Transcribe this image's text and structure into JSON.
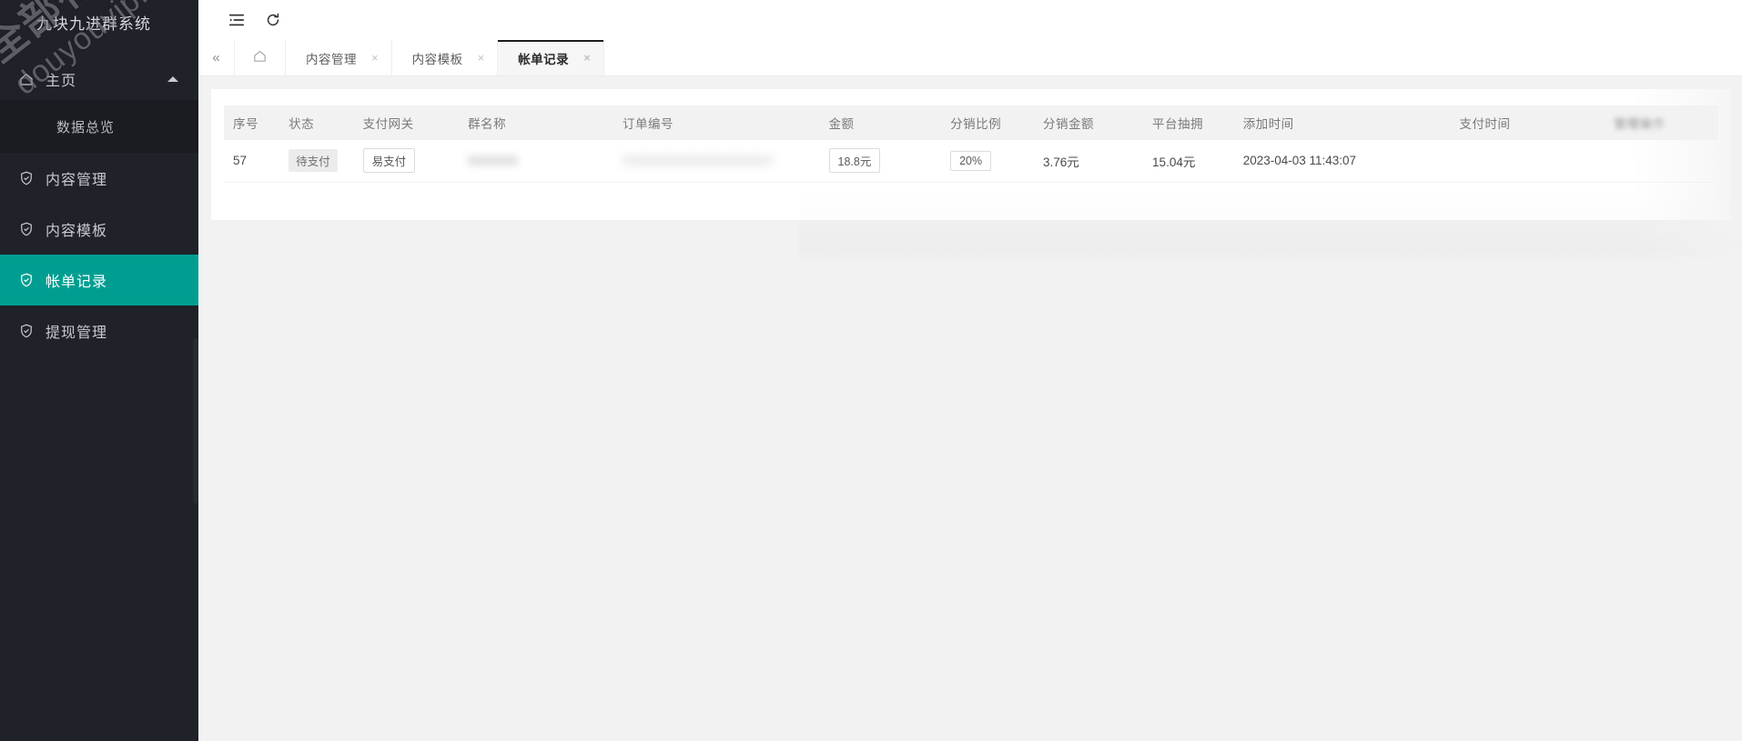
{
  "sidebar": {
    "logo_text": "九块九进群系统",
    "watermark_line1": "全部有综合资源网",
    "watermark_line2": "douyouvip.com",
    "group": {
      "label": "主页",
      "icon": "home-icon",
      "expanded": true,
      "children": [
        {
          "label": "数据总览"
        }
      ]
    },
    "items": [
      {
        "label": "内容管理",
        "icon": "shield-check-icon",
        "active": false
      },
      {
        "label": "内容模板",
        "icon": "shield-check-icon",
        "active": false
      },
      {
        "label": "帐单记录",
        "icon": "shield-check-icon",
        "active": true
      },
      {
        "label": "提现管理",
        "icon": "shield-check-icon",
        "active": false
      }
    ],
    "active_color": "#009e91",
    "bg_color": "#20222a"
  },
  "topbar": {
    "menu_toggle": "list-collapse-icon",
    "refresh": "refresh-icon"
  },
  "tabbar": {
    "collapse_label": "«",
    "home_icon": "home-outline-icon",
    "close_label": "×",
    "tabs": [
      {
        "label": "内容管理",
        "active": false,
        "closable": true
      },
      {
        "label": "内容模板",
        "active": false,
        "closable": true
      },
      {
        "label": "帐单记录",
        "active": true,
        "closable": true
      }
    ]
  },
  "table": {
    "columns": [
      {
        "key": "idx",
        "label": "序号"
      },
      {
        "key": "status",
        "label": "状态"
      },
      {
        "key": "gateway",
        "label": "支付网关"
      },
      {
        "key": "group",
        "label": "群名称"
      },
      {
        "key": "order",
        "label": "订单编号"
      },
      {
        "key": "amount",
        "label": "金额"
      },
      {
        "key": "ratio",
        "label": "分销比例"
      },
      {
        "key": "share",
        "label": "分销金额"
      },
      {
        "key": "plat",
        "label": "平台抽拥"
      },
      {
        "key": "addtime",
        "label": "添加时间"
      },
      {
        "key": "paytime",
        "label": "支付时间"
      },
      {
        "key": "op",
        "label": "管理操作"
      }
    ],
    "rows": [
      {
        "idx": "57",
        "status": "待支付",
        "gateway": "易支付",
        "group": "XXXXXX",
        "order": "XXXXXXXXXXXXXXXXXX",
        "amount": "18.8元",
        "ratio": "20%",
        "share": "3.76元",
        "plat": "15.04元",
        "addtime": "2023-04-03 11:43:07",
        "paytime": "",
        "op": ""
      }
    ]
  }
}
